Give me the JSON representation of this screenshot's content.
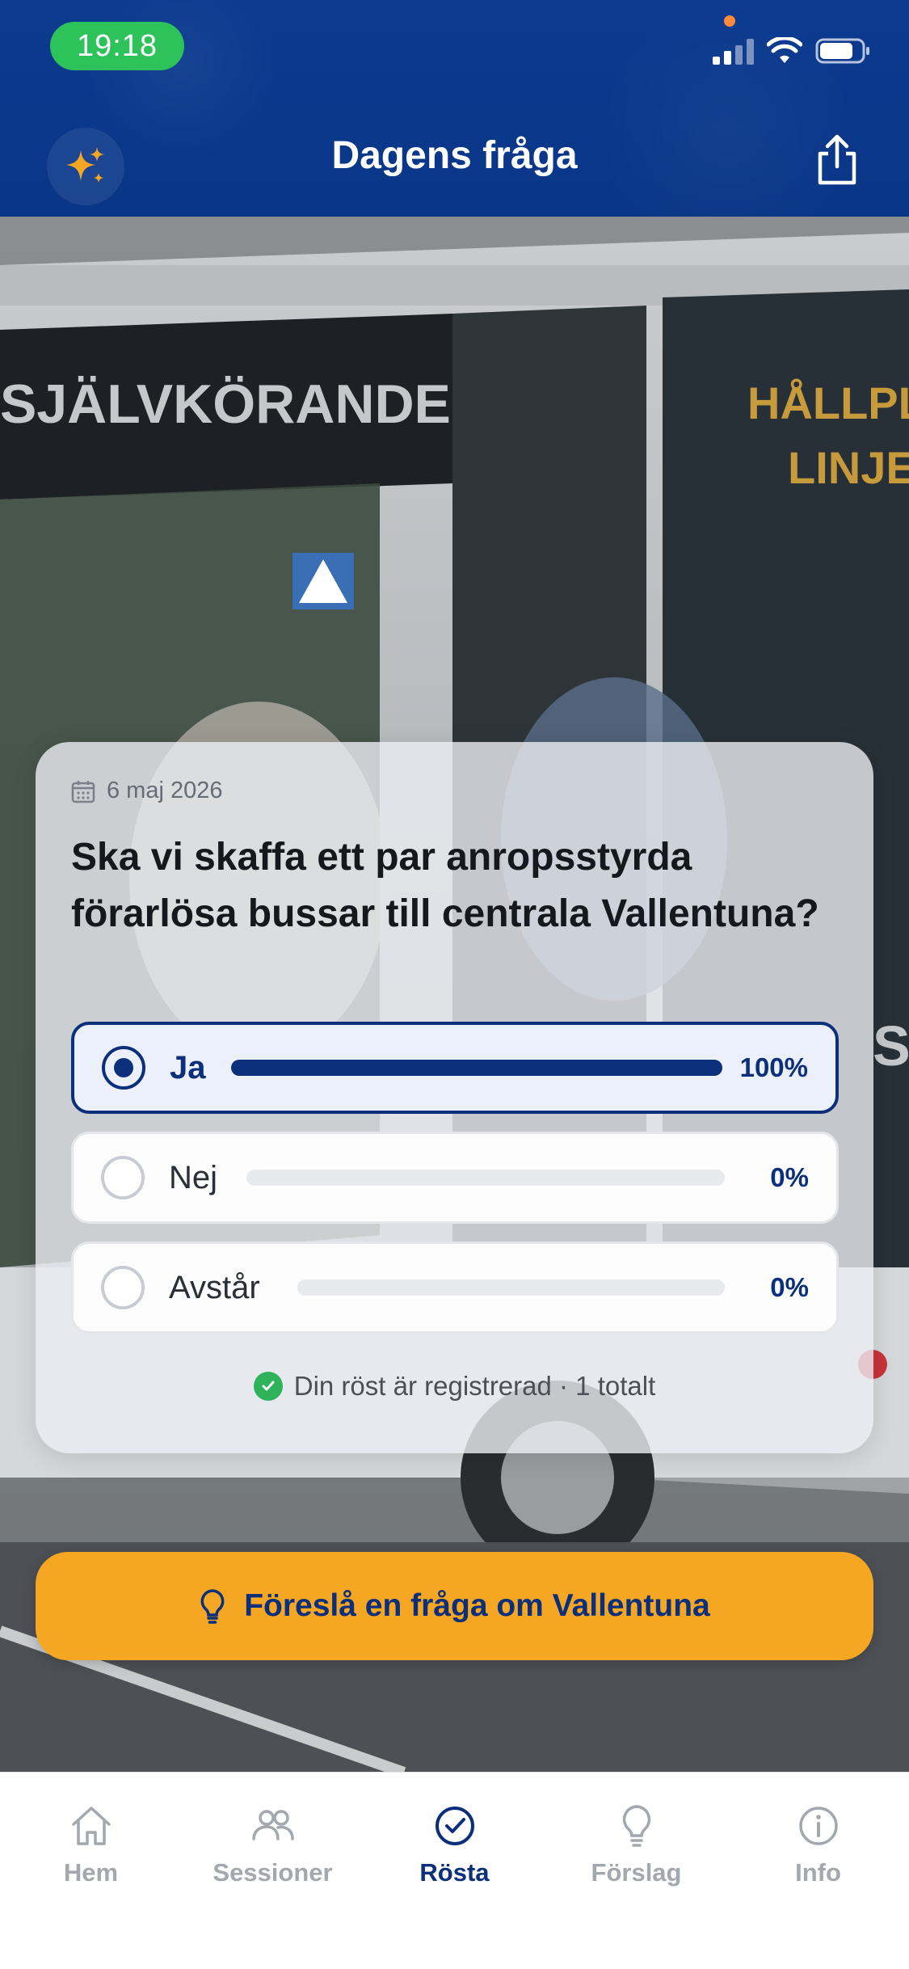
{
  "status_bar": {
    "time": "19:18"
  },
  "header": {
    "title": "Dagens fråga"
  },
  "card": {
    "date": "6 maj 2026",
    "question": "Ska vi skaffa ett par anropsstyrda förarlösa bussar till centrala Vallentuna?",
    "options": [
      {
        "label": "Ja",
        "percent_label": "100%",
        "fraction": 1.0,
        "selected": true
      },
      {
        "label": "Nej",
        "percent_label": "0%",
        "fraction": 0.0,
        "selected": false
      },
      {
        "label": "Avstår",
        "percent_label": "0%",
        "fraction": 0.0,
        "selected": false
      }
    ],
    "registered_text": "Din röst är registrerad · 1 totalt"
  },
  "suggest_button": {
    "label": "Föreslå en fråga om Vallentuna"
  },
  "tabs": [
    {
      "label": "Hem",
      "icon": "home-icon",
      "active": false
    },
    {
      "label": "Sessioner",
      "icon": "people-icon",
      "active": false
    },
    {
      "label": "Rösta",
      "icon": "check-circle-icon",
      "active": true
    },
    {
      "label": "Förslag",
      "icon": "lightbulb-icon",
      "active": false
    },
    {
      "label": "Info",
      "icon": "info-icon",
      "active": false
    }
  ],
  "photo": {
    "bus_side_text": "SJÄLVKÖRANDE",
    "destination_text_1": "HÅLLPLA",
    "destination_text_2": "LINJE",
    "side_text_small": "SJ"
  },
  "colors": {
    "brand_blue": "#0b2f7a",
    "header_blue": "#0b3a8f",
    "accent_orange": "#f5a623",
    "success_green": "#2eb35a"
  }
}
